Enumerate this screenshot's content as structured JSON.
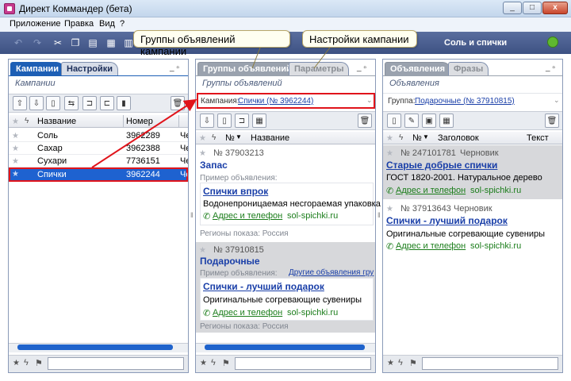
{
  "window": {
    "title": "Директ Коммандер (бета)",
    "minimize": "_",
    "restore": "□",
    "close": "x"
  },
  "menu": [
    "Приложение",
    "Правка",
    "Вид",
    "?"
  ],
  "toolbar": {
    "campaign_title": "Соль и спички"
  },
  "callouts": {
    "groups": "Группы объявлений кампании",
    "settings": "Настройки кампании"
  },
  "campaigns_panel": {
    "tabs": [
      "Кампании",
      "Настройки"
    ],
    "subtitle": "Кампании",
    "columns": [
      "Название",
      "Номер"
    ],
    "rows": [
      {
        "name": "Соль",
        "number": "3962289",
        "status": "Че"
      },
      {
        "name": "Сахар",
        "number": "3962388",
        "status": "Че"
      },
      {
        "name": "Сухари",
        "number": "7736151",
        "status": "Че"
      },
      {
        "name": "Спички",
        "number": "3962244",
        "status": "Че"
      }
    ]
  },
  "groups_panel": {
    "tabs": [
      "Группы объявлений",
      "Параметры"
    ],
    "subtitle": "Группы объявлений",
    "campaign_label": "Кампания:",
    "campaign_value": "Спички (№ 3962244)",
    "columns": [
      "№",
      "Название"
    ],
    "groups": [
      {
        "number": "№ 37903213",
        "name": "Запас",
        "example_label": "Пример объявления:",
        "other_link": "",
        "ad_title": "Спички впрок",
        "ad_text": "Водонепроницаемая несгораемая упаковка",
        "ad_contact": "Адрес и телефон",
        "ad_site": "sol-spichki.ru",
        "regions": "Регионы показа: Россия"
      },
      {
        "number": "№ 37910815",
        "name": "Подарочные",
        "example_label": "Пример объявления:",
        "other_link": "Другие объявления гру",
        "ad_title": "Спички - лучший подарок",
        "ad_text": "Оригинальные согревающие сувениры",
        "ad_contact": "Адрес и телефон",
        "ad_site": "sol-spichki.ru",
        "regions": "Регионы показа: Россия"
      }
    ]
  },
  "ads_panel": {
    "tabs": [
      "Объявления",
      "Фразы"
    ],
    "subtitle": "Объявления",
    "group_label": "Группа:",
    "group_value": "Подарочные (№ 37910815)",
    "columns": [
      "№",
      "Заголовок",
      "Текст"
    ],
    "ads": [
      {
        "number": "№ 247101781",
        "status": "Черновик",
        "title": "Старые добрые спички",
        "text": "ГОСТ 1820-2001. Натуральное дерево",
        "contact": "Адрес и телефон",
        "site": "sol-spichki.ru"
      },
      {
        "number": "№ 37913643",
        "status": "Черновик",
        "title": "Спички - лучший подарок",
        "text": "Оригинальные согревающие сувениры",
        "contact": "Адрес и телефон",
        "site": "sol-spichki.ru"
      }
    ]
  },
  "colors": {
    "accent": "#1e62d0",
    "annotation": "#e0141b",
    "toolbar": "#3d5283"
  }
}
